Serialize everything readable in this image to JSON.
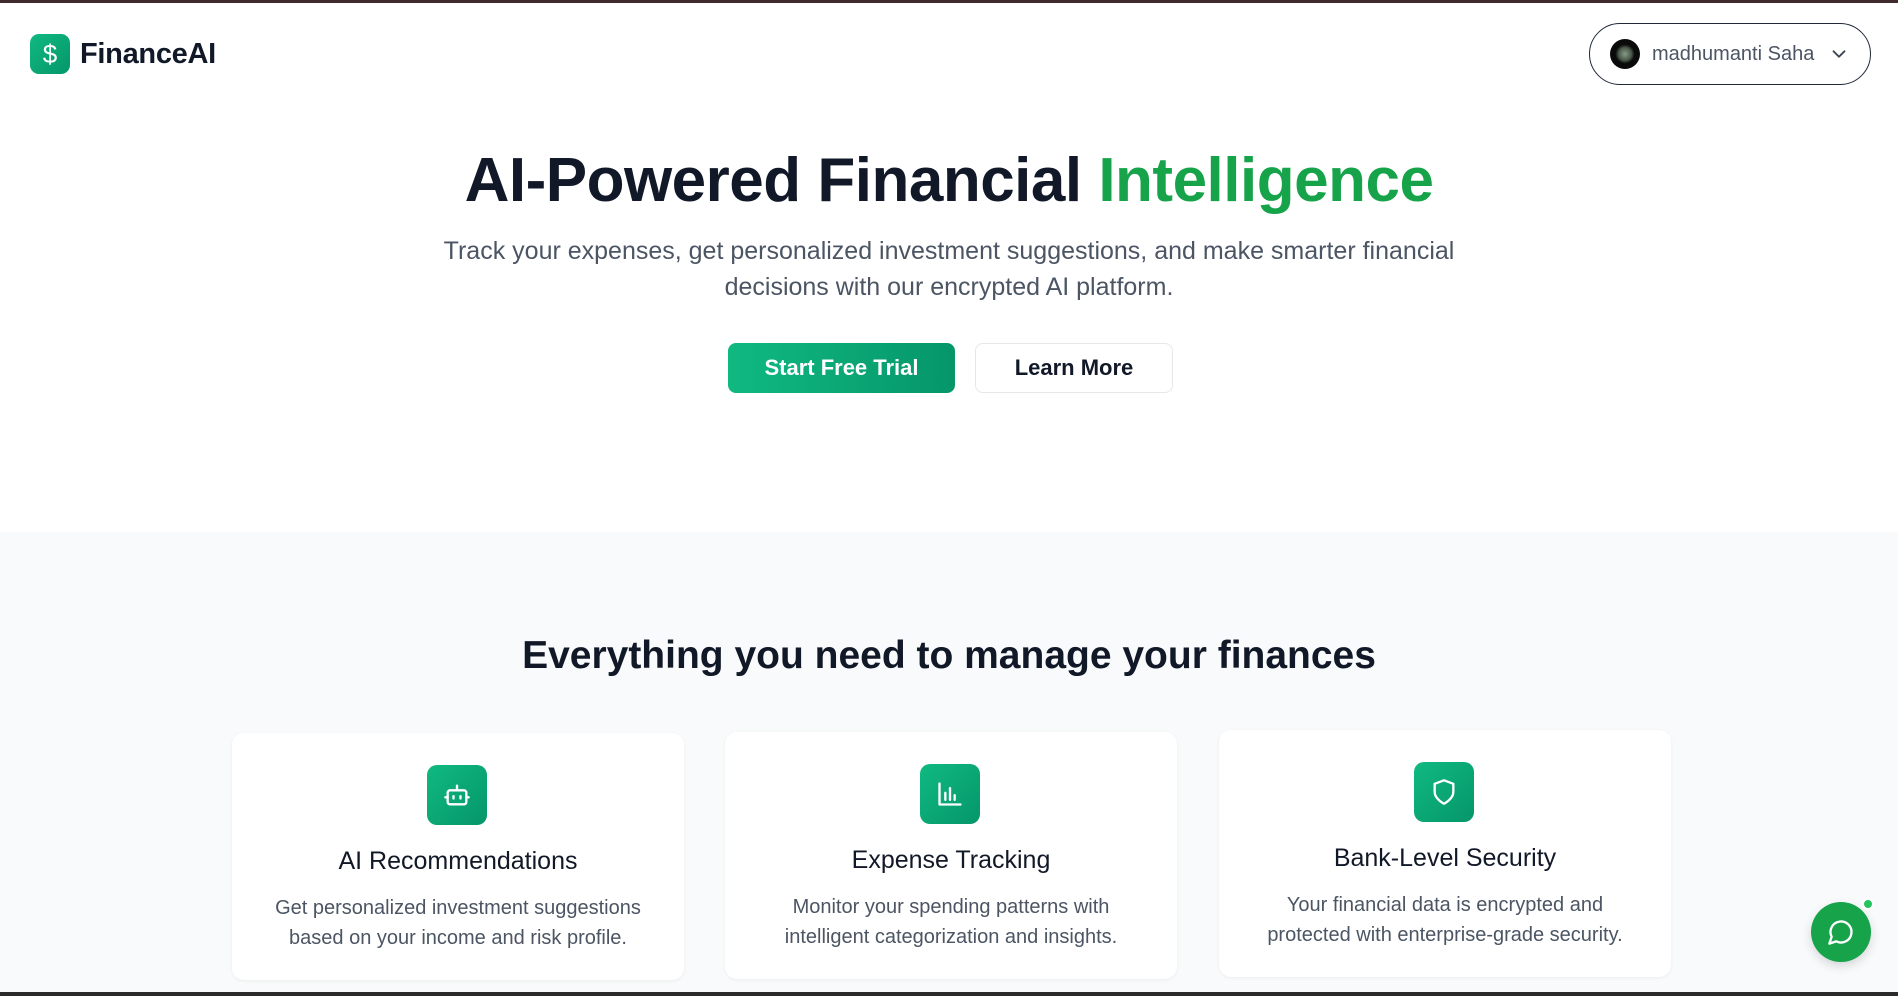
{
  "header": {
    "brand": "FinanceAI",
    "logo_symbol": "$",
    "user_name": "madhumanti Saha"
  },
  "hero": {
    "title_main": "AI-Powered Financial ",
    "title_accent": "Intelligence",
    "subtitle": "Track your expenses, get personalized investment suggestions, and make smarter financial decisions with our encrypted AI platform.",
    "primary_button": "Start Free Trial",
    "secondary_button": "Learn More"
  },
  "features": {
    "title": "Everything you need to manage your finances",
    "cards": [
      {
        "icon": "bot-icon",
        "title": "AI Recommendations",
        "description": "Get personalized investment suggestions based on your income and risk profile."
      },
      {
        "icon": "bar-chart-icon",
        "title": "Expense Tracking",
        "description": "Monitor your spending patterns with intelligent categorization and insights."
      },
      {
        "icon": "shield-icon",
        "title": "Bank-Level Security",
        "description": "Your financial data is encrypted and protected with enterprise-grade security."
      }
    ]
  },
  "chat": {
    "icon": "chat-bubble-icon",
    "status": "online"
  },
  "colors": {
    "accent": "#16a34a",
    "brand_gradient_start": "#10b981",
    "brand_gradient_end": "#059669",
    "text_primary": "#111827",
    "text_secondary": "#4b5563",
    "section_bg": "#f9fafb"
  }
}
